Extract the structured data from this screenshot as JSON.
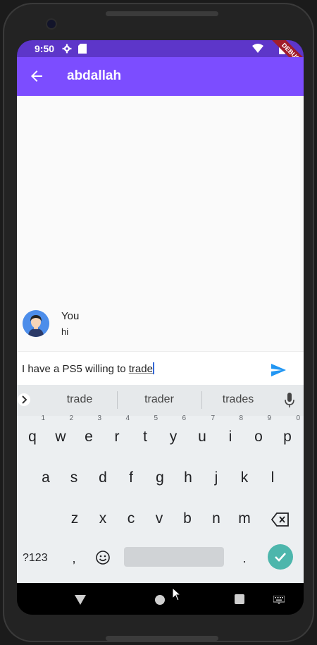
{
  "status": {
    "time": "9:50",
    "debug_label": "DEBUG"
  },
  "appbar": {
    "title": "abdallah"
  },
  "message": {
    "sender": "You",
    "text": "hi"
  },
  "input": {
    "text_before": "I have a PS5 willing to ",
    "text_underlined": "trade"
  },
  "keyboard": {
    "suggestions": [
      "trade",
      "trader",
      "trades"
    ],
    "row1": [
      {
        "key": "q",
        "hint": "1"
      },
      {
        "key": "w",
        "hint": "2"
      },
      {
        "key": "e",
        "hint": "3"
      },
      {
        "key": "r",
        "hint": "4"
      },
      {
        "key": "t",
        "hint": "5"
      },
      {
        "key": "y",
        "hint": "6"
      },
      {
        "key": "u",
        "hint": "7"
      },
      {
        "key": "i",
        "hint": "8"
      },
      {
        "key": "o",
        "hint": "9"
      },
      {
        "key": "p",
        "hint": "0"
      }
    ],
    "row2": [
      "a",
      "s",
      "d",
      "f",
      "g",
      "h",
      "j",
      "k",
      "l"
    ],
    "row3": [
      "z",
      "x",
      "c",
      "v",
      "b",
      "n",
      "m"
    ],
    "sym_label": "?123",
    "comma": ",",
    "period": "."
  },
  "colors": {
    "appbar": "#7c4dff",
    "statusbar": "#5d36c9",
    "send": "#2196f3",
    "enter": "#4db6ac"
  },
  "icons": [
    "back-arrow-icon",
    "send-icon",
    "mic-icon",
    "shift-icon",
    "backspace-icon",
    "emoji-icon",
    "check-icon",
    "chevron-right-icon",
    "settings-icon",
    "sd-card-icon",
    "wifi-icon",
    "battery-icon"
  ]
}
